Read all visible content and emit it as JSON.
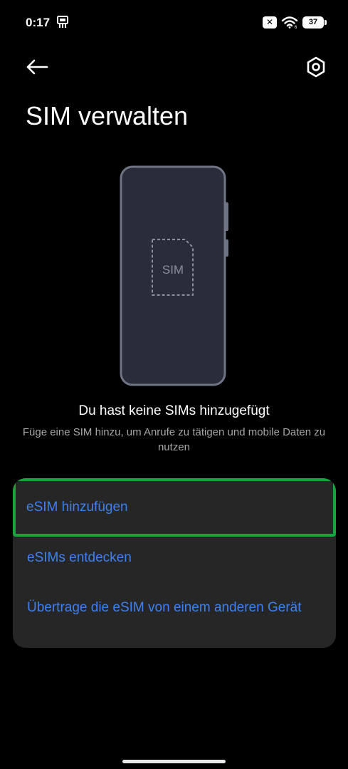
{
  "status_bar": {
    "time": "0:17",
    "battery_level": "37",
    "sim_status_icon": "sim-disabled-icon",
    "wifi_icon": "wifi-icon",
    "notification_icon": "notification-icon"
  },
  "header": {
    "back_icon": "arrow-left-icon",
    "settings_icon": "settings-icon",
    "title": "SIM verwalten"
  },
  "illustration": {
    "sim_label": "SIM"
  },
  "empty_state": {
    "title": "Du hast keine SIMs hinzugefügt",
    "subtitle": "Füge eine SIM hinzu, um Anrufe zu tätigen und mobile Daten zu nutzen"
  },
  "options": [
    {
      "label": "eSIM hinzufügen",
      "highlighted": true
    },
    {
      "label": "eSIMs entdecken"
    },
    {
      "label": "Übertrage die eSIM von einem anderen Gerät"
    }
  ],
  "colors": {
    "background": "#000000",
    "card": "#262626",
    "accent_link": "#3f80f0",
    "highlight_border": "#1aa33a",
    "subtitle_text": "#a6a6a6"
  }
}
